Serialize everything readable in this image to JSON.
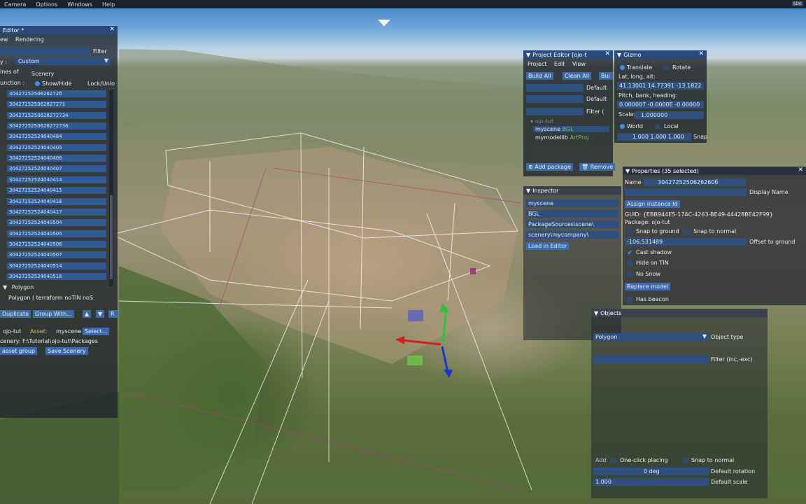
{
  "menubar": {
    "items": [
      "Camera",
      "Options",
      "Windows",
      "Help"
    ],
    "right_tag": "SDK"
  },
  "scenery_editor": {
    "title": "Editor *",
    "menu": [
      "ew",
      "Rendering"
    ],
    "filter_label": "Filter",
    "category_label": "y :",
    "category_value": "Custom",
    "lines_label": "ines of",
    "lines_value": "Scenery",
    "function_label": "unction :",
    "show_hide": "Show/Hide",
    "lock_unlock": "Lock/Unlo",
    "items": [
      "3042725250626272б",
      "304272525062627271",
      "3042725250626272734",
      "3042725250626272736",
      "30427252524040484",
      "30427252524040405",
      "30427252524040406",
      "30427252524040407",
      "30427252524040414",
      "30427252524040415",
      "30427252524040416",
      "30427252524040417",
      "30427252524040504",
      "30427252524040505",
      "30427252524040506",
      "30427252524040507",
      "30427252524040514",
      "30427252524040516"
    ],
    "polygon_header": "Polygon",
    "polygon_item": "Polygon  ( terraform noTIN noS",
    "duplicate": "Duplicate",
    "group_with": "Group With...",
    "project_label": "ojo-tut",
    "asset_label": "Asset:",
    "asset_value": "myscene",
    "select_btn": "Select...",
    "scenery_path": "cenery: F:\\Tutorial\\ojo-tut\\Packages",
    "asset_group": "asset group",
    "save_scenery": "Save Scenery"
  },
  "project_editor": {
    "title": "Project Editor [ojo-t",
    "menu": [
      "Project",
      "Edit",
      "View"
    ],
    "build_all": "Build All",
    "clean_all": "Clean All",
    "bui": "Bui",
    "default1": "Default",
    "default2": "Default",
    "filter": "Filter (",
    "tree_root": "ojo-tut",
    "tree_items": [
      {
        "name": "myscene",
        "tag": "BGL"
      },
      {
        "name": "mymodellib",
        "tag": "ArtProj"
      }
    ],
    "add_package": "Add package",
    "remove": "Remove"
  },
  "gizmo": {
    "title": "Gizmo",
    "translate": "Translate",
    "rotate": "Rotate",
    "latlon_label": "Lat, long, alt:",
    "latlon_value": "41.13001  14.77391  -13.1822",
    "pbh_label": "Pitch, bank, heading:",
    "pbh_value": "0.000007  -0.0000E  -0.00000",
    "scale_label": "Scale:",
    "scale_value": "1.000000",
    "world": "World",
    "local": "Local",
    "snap_values": "1.000  1.000  1.000",
    "snap": "Snap"
  },
  "inspector": {
    "title": "Inspector",
    "rows": [
      "myscene",
      "BGL",
      "PackageSources\\scene\\",
      "scenery\\mycompany\\"
    ],
    "load_btn": "Load in Editor"
  },
  "properties": {
    "title": "Properties (35 selected)",
    "name_label": "Name :",
    "name_value": "3042725250626260б",
    "display_name": "Display Name",
    "assign_btn": "Assign instance Id",
    "guid": "GUID: {EBB944E5-17AC-4263-BE49-44428BE42F99}",
    "package": "Package: ojo-tut",
    "snap_ground": "Snap to ground",
    "snap_normal": "Snap to normal",
    "offset_value": "-106.531489",
    "offset_label": "Offset to ground",
    "cast_shadow": "Cast shadow",
    "hide_tin": "Hide on TIN",
    "no_snow": "No Snow",
    "replace_btn": "Replace model",
    "has_beacon": "Has beacon"
  },
  "objects": {
    "title": "Objects",
    "type_value": "Polygon",
    "type_label": "Object type",
    "filter_label": "Filter (inc,-exc)",
    "add": "Add",
    "one_click": "One-click placing",
    "snap_normal": "Snap to normal",
    "rotation_value": "0 deg",
    "rotation_label": "Default rotation",
    "scale_value": "1.000",
    "scale_label": "Default scale"
  }
}
